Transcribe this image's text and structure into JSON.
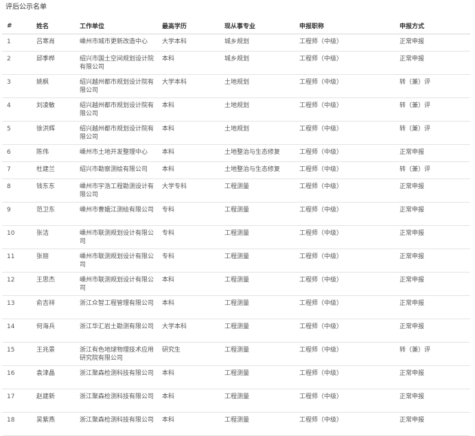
{
  "page_title": "评后公示名单",
  "table": {
    "headers": [
      "#",
      "姓名",
      "工作单位",
      "最高学历",
      "现从事专业",
      "申报职称",
      "申报方式"
    ],
    "rows": [
      [
        "1",
        "吕寒肖",
        "嵊州市城市更新改造中心",
        "大学本科",
        "城乡规划",
        "工程师（中级）",
        "正常申报"
      ],
      [
        "2",
        "邱季桦",
        "绍兴市国土空间规划设计院有限公司",
        "本科",
        "城乡规划",
        "工程师（中级）",
        "正常申报"
      ],
      [
        "3",
        "姚枫",
        "绍兴越州都市规划设计院有限公司",
        "大学本科",
        "土地规划",
        "工程师（中级）",
        "转（兼）评"
      ],
      [
        "4",
        "刘凌敏",
        "绍兴越州都市规划设计院有限公司",
        "本科",
        "土地规划",
        "工程师（中级）",
        "转（兼）评"
      ],
      [
        "5",
        "徐洪辉",
        "绍兴越州都市规划设计院有限公司",
        "本科",
        "土地规划",
        "工程师（中级）",
        "转（兼）评"
      ],
      [
        "6",
        "陈伟",
        "嵊州市土地开发整理中心",
        "本科",
        "土地整治与生态修复",
        "工程师（中级）",
        "正常申报"
      ],
      [
        "7",
        "杜建兰",
        "绍兴市勘察测绘有限公司",
        "本科",
        "土地整治与生态修复",
        "工程师（中级）",
        "转（兼）评"
      ],
      [
        "8",
        "钱东东",
        "嵊州市宇浩工程勘测设计有限公司",
        "大学专科",
        "工程测量",
        "工程师（中级）",
        "正常申报"
      ],
      [
        "9",
        "范卫东",
        "嵊州市曹娥江测绘有限公司",
        "专科",
        "工程测量",
        "工程师（中级）",
        "正常申报"
      ],
      [
        "10",
        "张洁",
        "嵊州市联测规划设计有限公司",
        "专科",
        "工程测量",
        "工程师（中级）",
        "正常申报"
      ],
      [
        "11",
        "张丽",
        "嵊州市联测规划设计有限公司",
        "专科",
        "工程测量",
        "工程师（中级）",
        "正常申报"
      ],
      [
        "12",
        "王思杰",
        "嵊州市联测规划设计有限公司",
        "本科",
        "工程测量",
        "工程师（中级）",
        "正常申报"
      ],
      [
        "13",
        "俞吉祥",
        "浙江众智工程管理有限公司",
        "本科",
        "工程测量",
        "工程师（中级）",
        "正常申报"
      ],
      [
        "14",
        "何海兵",
        "浙江华汇岩土勘测有限公司",
        "大学本科",
        "工程测量",
        "工程师（中级）",
        "正常申报"
      ],
      [
        "15",
        "王兆景",
        "浙江有色地球物理技术应用研究院有限公司",
        "研究生",
        "工程测量",
        "工程师（中级）",
        "转（兼）评"
      ],
      [
        "16",
        "袁津晶",
        "浙江聚森检测科技有限公司",
        "本科",
        "工程测量",
        "工程师（中级）",
        "正常申报"
      ],
      [
        "17",
        "赵建新",
        "浙江聚森检测科技有限公司",
        "本科",
        "工程测量",
        "工程师（中级）",
        "正常申报"
      ],
      [
        "18",
        "吴紫燕",
        "浙江聚森检测科技有限公司",
        "本科",
        "工程测量",
        "工程师（中级）",
        "正常申报"
      ]
    ]
  }
}
